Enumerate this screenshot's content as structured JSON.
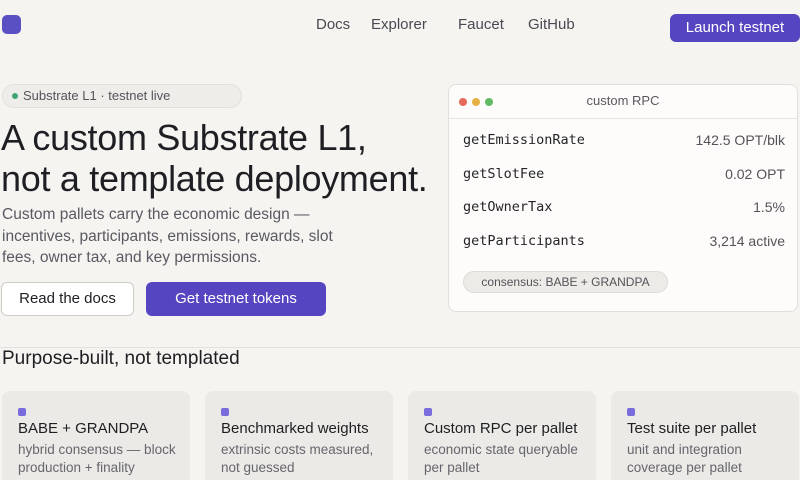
{
  "nav": {
    "links": [
      "Docs",
      "Explorer",
      "Faucet",
      "GitHub"
    ],
    "cta": "Launch testnet"
  },
  "hero": {
    "badge": "Substrate L1 · testnet live",
    "title_line1": "A custom Substrate L1,",
    "title_line2": "not a template deployment.",
    "description": "Custom pallets carry the economic design — incentives, participants, emissions, rewards, slot fees, owner tax, and key permissions.",
    "secondary_button": "Read the docs",
    "primary_button": "Get testnet tokens"
  },
  "rpc": {
    "title": "custom RPC",
    "rows": [
      {
        "method": "getEmissionRate",
        "value": "142.5 OPT/blk"
      },
      {
        "method": "getSlotFee",
        "value": "0.02 OPT"
      },
      {
        "method": "getOwnerTax",
        "value": "1.5%"
      },
      {
        "method": "getParticipants",
        "value": "3,214 active"
      }
    ],
    "consensus": "consensus: BABE + GRANDPA"
  },
  "features": {
    "heading": "Purpose-built, not templated",
    "cards": [
      {
        "title": "BABE + GRANDPA",
        "desc": "hybrid consensus — block production + finality"
      },
      {
        "title": "Benchmarked weights",
        "desc": "extrinsic costs measured, not guessed"
      },
      {
        "title": "Custom RPC per pallet",
        "desc": "economic state queryable per pallet"
      },
      {
        "title": "Test suite per pallet",
        "desc": "unit and integration coverage per pallet"
      }
    ]
  },
  "colors": {
    "accent": "#5645c0",
    "background": "#f5f4f1",
    "status_live": "#3fa673"
  }
}
